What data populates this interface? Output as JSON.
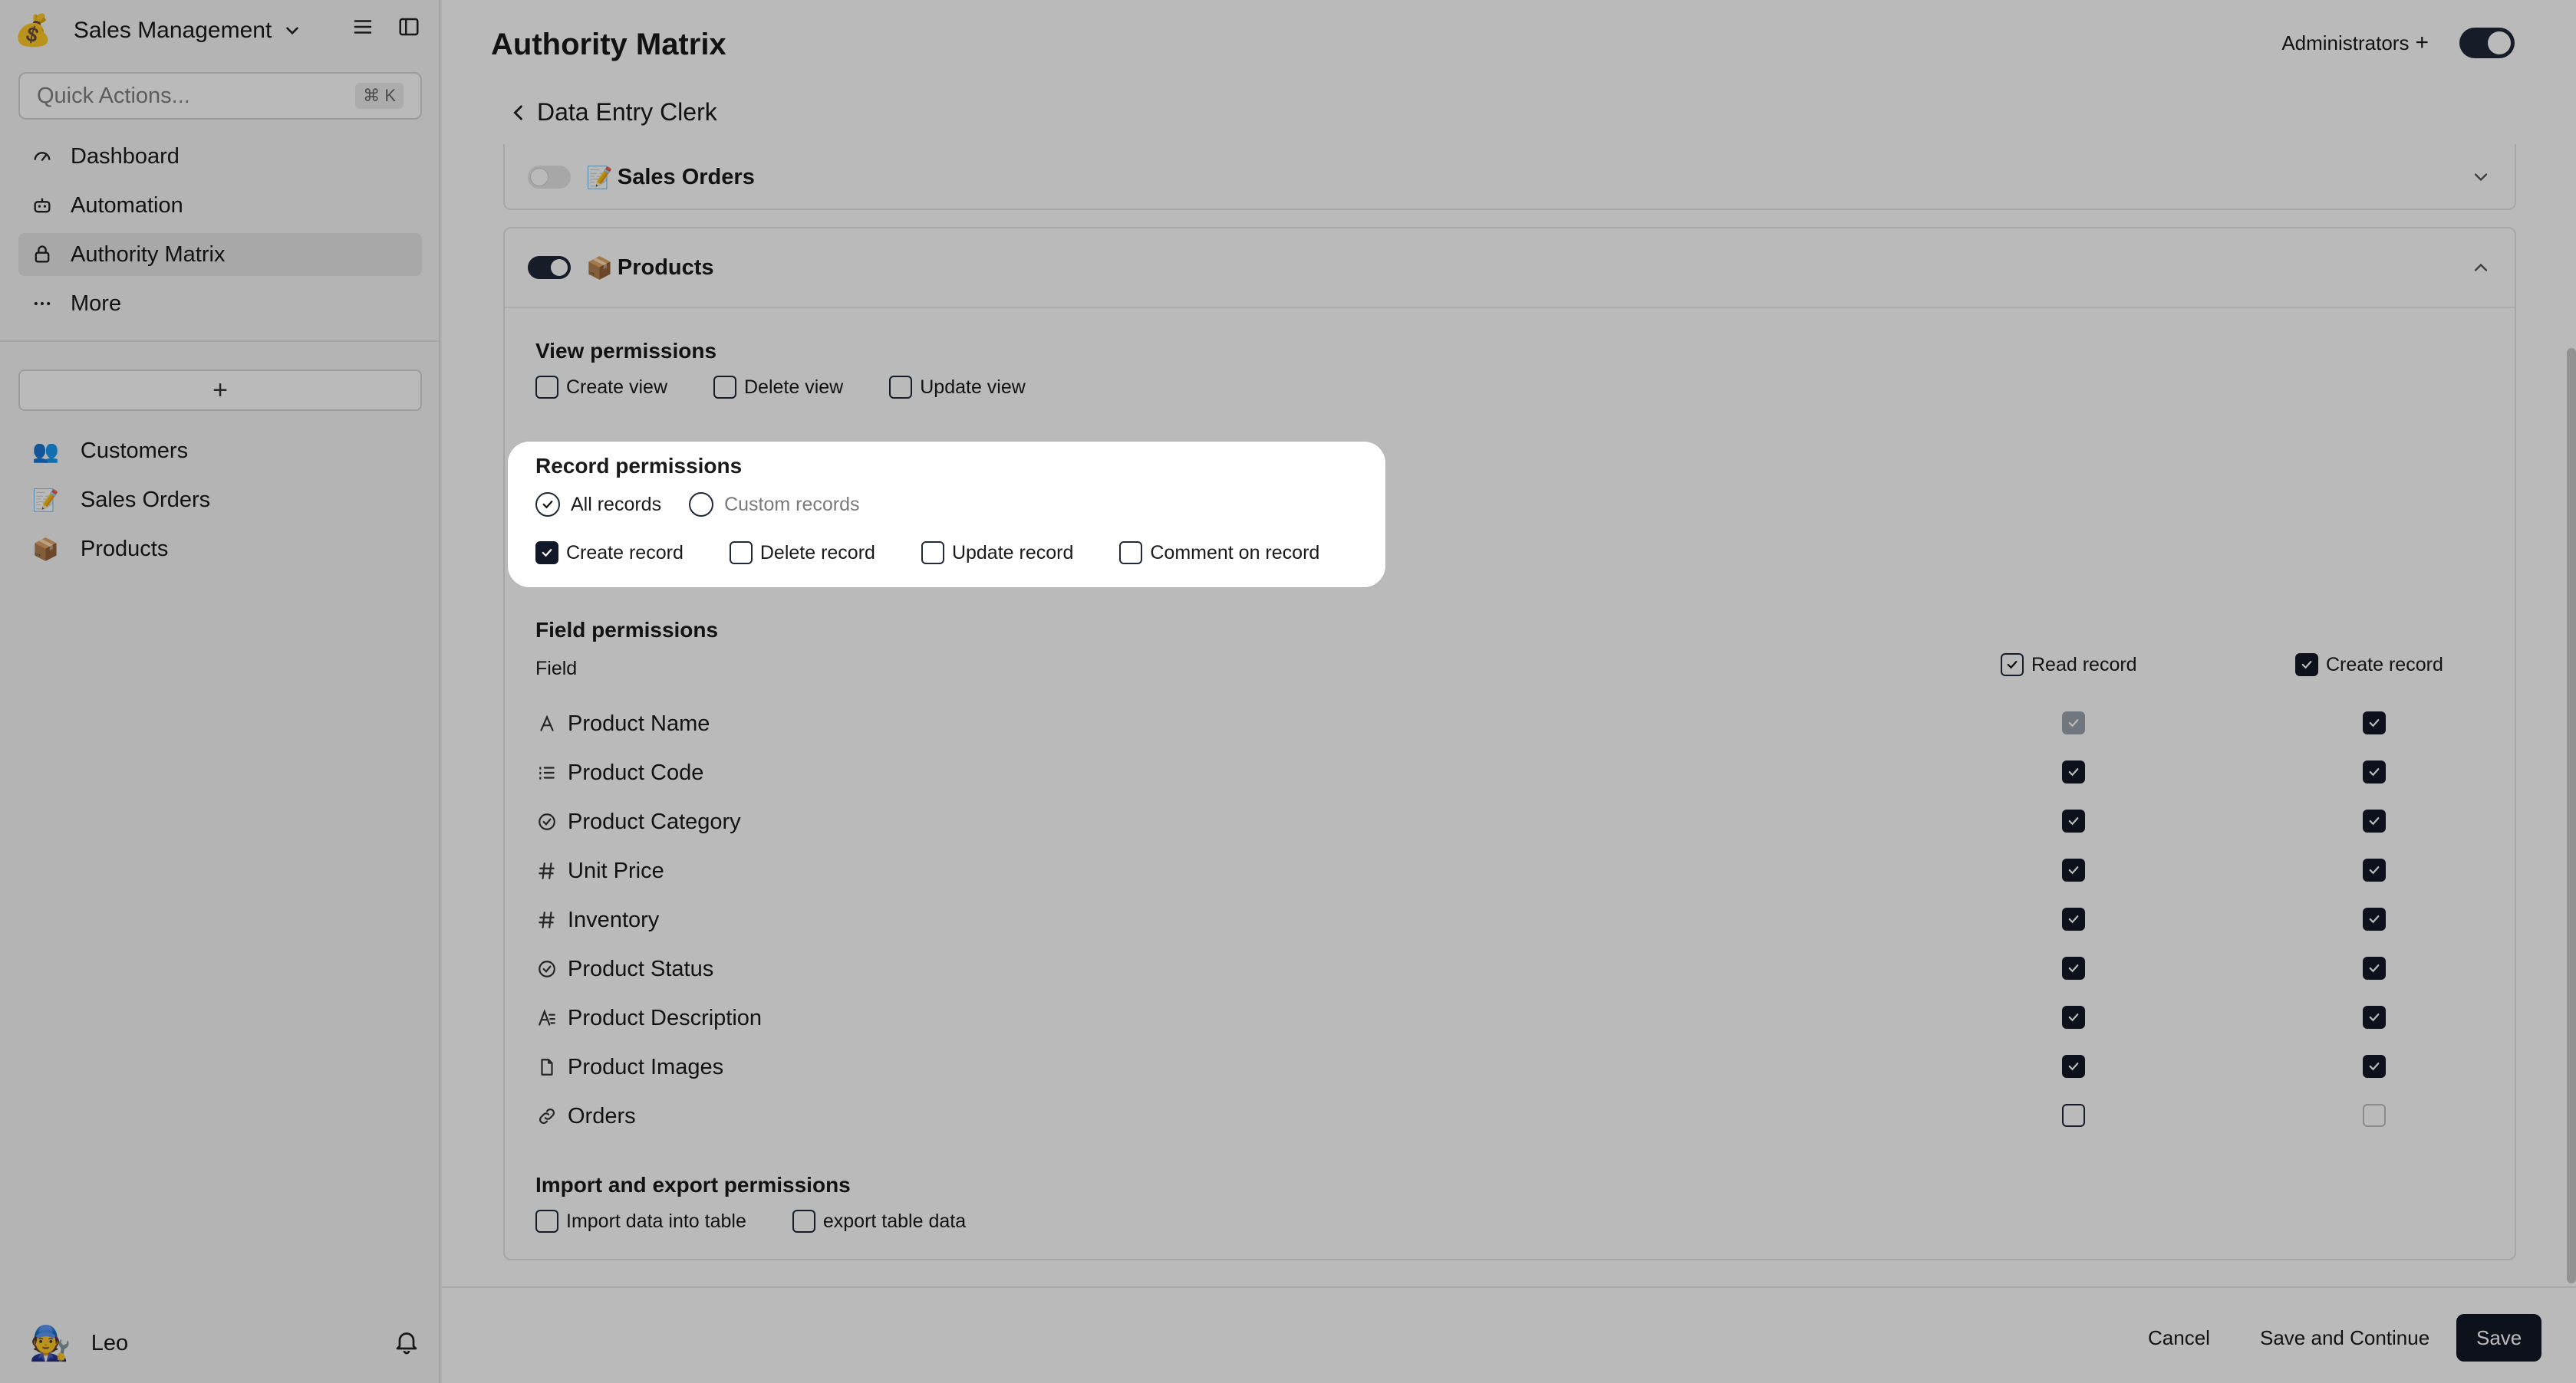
{
  "workspace": {
    "name": "Sales Management",
    "logo": "💰"
  },
  "quick_actions": {
    "placeholder": "Quick Actions...",
    "shortcut": "⌘ K"
  },
  "nav": [
    {
      "label": "Dashboard",
      "icon": "dashboard-icon"
    },
    {
      "label": "Automation",
      "icon": "robot-icon"
    },
    {
      "label": "Authority Matrix",
      "icon": "lock-icon"
    },
    {
      "label": "More",
      "icon": "more-icon"
    }
  ],
  "add_label": "+",
  "tables": [
    {
      "emoji": "👥",
      "label": "Customers"
    },
    {
      "emoji": "📝",
      "label": "Sales Orders"
    },
    {
      "emoji": "📦",
      "label": "Products"
    }
  ],
  "user": {
    "name": "Leo",
    "avatar": "🧑‍🔧"
  },
  "header": {
    "title": "Authority Matrix",
    "role_label": "Administrators",
    "role_plus": "+"
  },
  "back": {
    "label": "Data Entry Clerk"
  },
  "sections": {
    "sales_orders": {
      "emoji": "📝",
      "title": "Sales Orders"
    },
    "products": {
      "emoji": "📦",
      "title": "Products"
    }
  },
  "view_permissions": {
    "title": "View permissions",
    "items": [
      "Create view",
      "Delete view",
      "Update view"
    ]
  },
  "record_permissions": {
    "title": "Record permissions",
    "scope": [
      "All records",
      "Custom records"
    ],
    "items": [
      "Create record",
      "Delete record",
      "Update record",
      "Comment on record"
    ]
  },
  "field_permissions": {
    "title": "Field permissions",
    "field_col": "Field",
    "col_read": "Read record",
    "col_create": "Create record",
    "rows": [
      {
        "name": "Product Name",
        "icon": "text-icon",
        "read": "grey-on",
        "create": "on"
      },
      {
        "name": "Product Code",
        "icon": "list-number-icon",
        "read": "on",
        "create": "on"
      },
      {
        "name": "Product Category",
        "icon": "select-icon",
        "read": "on",
        "create": "on"
      },
      {
        "name": "Unit Price",
        "icon": "hash-icon",
        "read": "on",
        "create": "on"
      },
      {
        "name": "Inventory",
        "icon": "hash-icon",
        "read": "on",
        "create": "on"
      },
      {
        "name": "Product Status",
        "icon": "select-icon",
        "read": "on",
        "create": "on"
      },
      {
        "name": "Product Description",
        "icon": "long-text-icon",
        "read": "on",
        "create": "on"
      },
      {
        "name": "Product Images",
        "icon": "file-icon",
        "read": "on",
        "create": "on"
      },
      {
        "name": "Orders",
        "icon": "link-icon",
        "read": "off",
        "create": "grey-off"
      }
    ]
  },
  "import_export": {
    "title": "Import and export permissions",
    "items": [
      "Import data into table",
      "export table data"
    ]
  },
  "footer": {
    "cancel": "Cancel",
    "save_continue": "Save and Continue",
    "save": "Save"
  }
}
